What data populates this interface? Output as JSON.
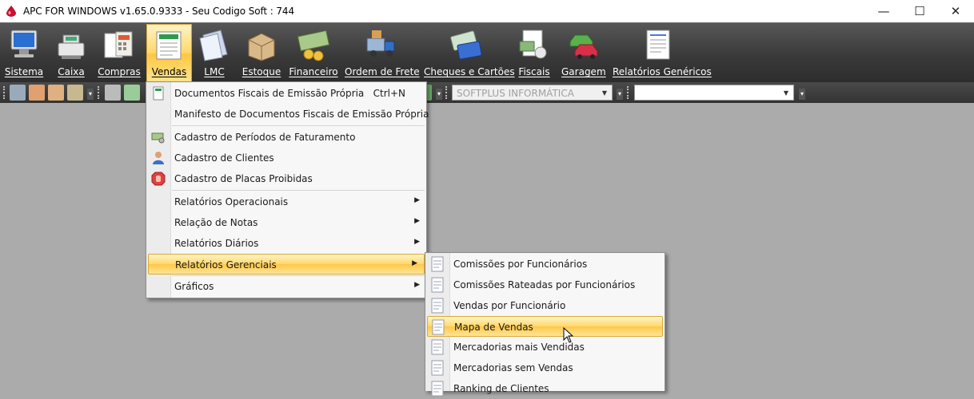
{
  "window": {
    "title": "APC FOR WINDOWS v1.65.0.9333 - Seu Codigo Soft : 744",
    "min_glyph": "—",
    "max_glyph": "☐",
    "close_glyph": "✕"
  },
  "ribbon": {
    "items": [
      {
        "label": "Sistema",
        "icon": "monitor-icon"
      },
      {
        "label": "Caixa",
        "icon": "cash-register-icon"
      },
      {
        "label": "Compras",
        "icon": "calculator-icon"
      },
      {
        "label": "Vendas",
        "icon": "invoice-icon",
        "active": true
      },
      {
        "label": "LMC",
        "icon": "documents-icon"
      },
      {
        "label": "Estoque",
        "icon": "box-icon"
      },
      {
        "label": "Financeiro",
        "icon": "money-icon"
      },
      {
        "label": "Ordem de Frete",
        "icon": "truck-icon"
      },
      {
        "label": "Cheques e Cartões",
        "icon": "cards-icon"
      },
      {
        "label": "Fiscais",
        "icon": "tax-icon"
      },
      {
        "label": "Garagem",
        "icon": "cars-icon"
      },
      {
        "label": "Relatórios Genéricos",
        "icon": "report-icon"
      }
    ]
  },
  "toolbar": {
    "company_combo": "SOFTPLUS INFORMÁTICA",
    "second_combo": ""
  },
  "vendas_menu": {
    "items": [
      {
        "label": "Documentos Fiscais de Emissão Própria",
        "shortcut": "Ctrl+N"
      },
      {
        "label": "Manifesto de Documentos Fiscais de Emissão Própria"
      },
      {
        "label": "Cadastro de Períodos de Faturamento"
      },
      {
        "label": "Cadastro de Clientes"
      },
      {
        "label": "Cadastro de Placas Proibidas"
      },
      {
        "label": "Relatórios Operacionais"
      },
      {
        "label": "Relação de Notas"
      },
      {
        "label": "Relatórios Diários"
      },
      {
        "label": "Relatórios Gerenciais"
      },
      {
        "label": "Gráficos"
      }
    ],
    "submenu_arrow": "▶"
  },
  "gerenciais_menu": {
    "items": [
      {
        "label": "Comissões por Funcionários"
      },
      {
        "label": "Comissões Rateadas por Funcionários"
      },
      {
        "label": "Vendas por Funcionário"
      },
      {
        "label": "Mapa de Vendas"
      },
      {
        "label": "Mercadorias mais Vendidas"
      },
      {
        "label": "Mercadorias sem Vendas"
      },
      {
        "label": "Ranking de Clientes"
      }
    ]
  },
  "colors": {
    "ribbon_bg": "#3a3a3a",
    "highlight": "#ffd86b",
    "workspace": "#ababab"
  }
}
